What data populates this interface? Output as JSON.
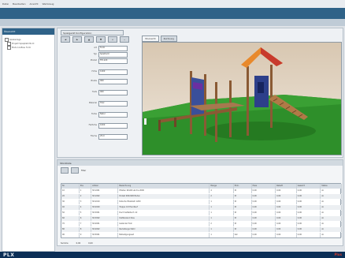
{
  "menu": [
    "Datei",
    "Bearbeiten",
    "Ansicht",
    "Werkzeug"
  ],
  "left_panel": {
    "title": "Übersicht",
    "items": [
      "Spielanlage",
      "Projekt Spielplatz Nord",
      "Modul Aufbau Turm"
    ]
  },
  "main": {
    "doc_tab": "Spielgerät Konfiguration",
    "toolbar": [
      "◄",
      "►",
      "▲",
      "▼",
      "+",
      "−"
    ],
    "view_tabs": [
      "3D-Ansicht",
      "Zeichnung"
    ],
    "form_fields": [
      {
        "label": "Art",
        "value": "Turm"
      },
      {
        "label": "Typ",
        "value": "Spielturm"
      },
      {
        "label": "Modell",
        "value": "TM-120"
      },
      {
        "label": "Höhe",
        "value": "1200"
      },
      {
        "label": "Breite",
        "value": "900"
      },
      {
        "label": "Tiefe",
        "value": "900"
      },
      {
        "label": "Material",
        "value": "Holz"
      },
      {
        "label": "Farbe",
        "value": "Natur"
      },
      {
        "label": "Fallhöhe",
        "value": "1000"
      },
      {
        "label": "Fläche",
        "value": "25,0"
      }
    ]
  },
  "grid_panel": {
    "title": "Stückliste",
    "tools_label": "Filter",
    "columns": [
      "Nr.",
      "Pos",
      "Artikel",
      "Bezeichnung",
      "Menge",
      "Einh.",
      "Preis",
      "Rabatt",
      "Gesamt",
      "Status"
    ],
    "rows": [
      [
        "10",
        "1",
        "SP-1001",
        "Pfosten 90x90 Lärche 2000",
        "4",
        "St",
        "0,00",
        "0,00",
        "0,00",
        "ok"
      ],
      [
        "20",
        "2",
        "SP-1002",
        "Podest 900x900 Boden",
        "2",
        "St",
        "0,00",
        "0,00",
        "0,00",
        "ok"
      ],
      [
        "30",
        "3",
        "SP-2010",
        "Rutsche Edelstahl 1200",
        "1",
        "St",
        "0,00",
        "0,00",
        "0,00",
        "ok"
      ],
      [
        "40",
        "4",
        "SP-2020",
        "Treppe mit Handlauf",
        "1",
        "St",
        "0,00",
        "0,00",
        "0,00",
        "ok"
      ],
      [
        "50",
        "5",
        "SP-3001",
        "Dach Satteldach rot",
        "1",
        "St",
        "0,00",
        "0,00",
        "0,00",
        "ok"
      ],
      [
        "60",
        "6",
        "SP-3002",
        "Kletterwand blau",
        "1",
        "St",
        "0,00",
        "0,00",
        "0,00",
        "ok"
      ],
      [
        "70",
        "7",
        "SP-4001",
        "Geländer Holz",
        "2",
        "St",
        "0,00",
        "0,00",
        "0,00",
        "ok"
      ],
      [
        "80",
        "8",
        "SP-4002",
        "Reckstange Stahl",
        "1",
        "St",
        "0,00",
        "0,00",
        "0,00",
        "ok"
      ],
      [
        "90",
        "9",
        "SP-5001",
        "Befestigungsset",
        "1",
        "Set",
        "0,00",
        "0,00",
        "0,00",
        "ok"
      ]
    ],
    "footer": [
      "Summe",
      "0,00",
      "0,00"
    ]
  },
  "status": {
    "logo_text": "PLX",
    "brand_text": "Plus"
  },
  "colors": {
    "title_blue": "#2f6288",
    "ground_green": "#2e8f2a",
    "sky": "#e3d7c7",
    "wall": "#d9c8b3",
    "roof_orange": "#e8892c",
    "roof_red": "#c83a2c",
    "tower_blue": "#3a4f9a",
    "wood": "#8a5a34",
    "status_dark": "#0b2e56"
  }
}
